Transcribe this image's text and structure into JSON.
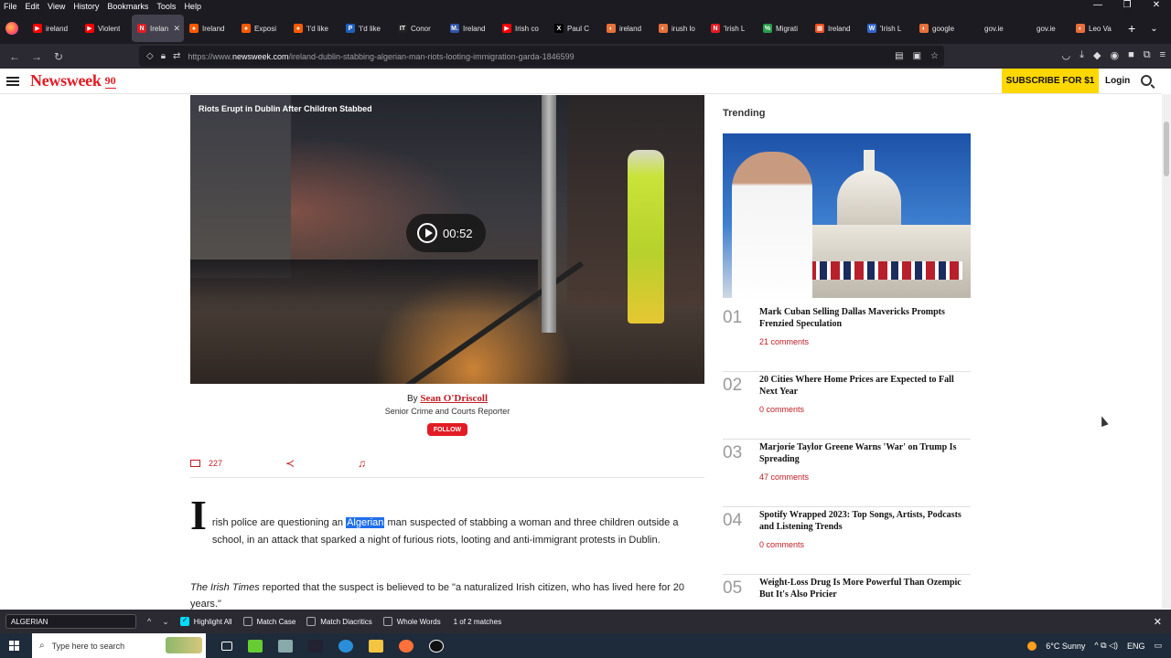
{
  "browser": {
    "menu": [
      "File",
      "Edit",
      "View",
      "History",
      "Bookmarks",
      "Tools",
      "Help"
    ],
    "window_controls": {
      "minimize": "—",
      "restore": "❐",
      "close": "✕"
    },
    "tabs": [
      {
        "label": "ireland",
        "color": "#ff0000",
        "glyph": "▶"
      },
      {
        "label": "Violent",
        "color": "#ff0000",
        "glyph": "▶"
      },
      {
        "label": "Irelan",
        "color": "#e21c24",
        "glyph": "N",
        "active": true
      },
      {
        "label": "Ireland",
        "color": "#ff5a00",
        "glyph": "●"
      },
      {
        "label": "Exposi",
        "color": "#ff5a00",
        "glyph": "●"
      },
      {
        "label": "'I'd like",
        "color": "#ff5a00",
        "glyph": "●"
      },
      {
        "label": "'I'd like",
        "color": "#1e5fbf",
        "glyph": "P"
      },
      {
        "label": "Conor",
        "color": "#222222",
        "glyph": "IT"
      },
      {
        "label": "Ireland",
        "color": "#3355aa",
        "glyph": "M."
      },
      {
        "label": "Irish co",
        "color": "#ff0000",
        "glyph": "▶"
      },
      {
        "label": "Paul C",
        "color": "#000000",
        "glyph": "X"
      },
      {
        "label": "ireland",
        "color": "#e8703a",
        "glyph": "◐"
      },
      {
        "label": "irush lo",
        "color": "#e8703a",
        "glyph": "◐"
      },
      {
        "label": "'Irish L",
        "color": "#e21c24",
        "glyph": "N"
      },
      {
        "label": "Migrati",
        "color": "#2a9d4a",
        "glyph": "%"
      },
      {
        "label": "Ireland",
        "color": "#f25022",
        "glyph": "▦"
      },
      {
        "label": "'Irish L",
        "color": "#3366cc",
        "glyph": "W"
      },
      {
        "label": "google",
        "color": "#e8703a",
        "glyph": "◐"
      },
      {
        "label": "gov.ie",
        "color": "#1c1b22",
        "glyph": ""
      },
      {
        "label": "gov.ie",
        "color": "#1c1b22",
        "glyph": ""
      },
      {
        "label": "Leo Va",
        "color": "#e8703a",
        "glyph": "◐"
      }
    ],
    "tab_close": "✕",
    "new_tab": "+",
    "tab_list": "⌄",
    "url_prefix": "https://www.",
    "url_domain": "newsweek.com",
    "url_path": "/ireland-dublin-stabbing-algerian-man-riots-looting-immigration-garda-1846599",
    "nav": {
      "back": "←",
      "forward": "→",
      "reload": "↻"
    }
  },
  "site": {
    "logo": "Newsweek",
    "logo_badge": "90",
    "subscribe": "SUBSCRIBE FOR $1",
    "login": "Login"
  },
  "article": {
    "video_title": "Riots Erupt in Dublin After Children Stabbed",
    "video_duration": "00:52",
    "by": "By",
    "author": "Sean O'Driscoll",
    "role": "Senior Crime and Courts Reporter",
    "follow": "FOLLOW",
    "comment_count": "227",
    "dropcap": "I",
    "para1_a": "rish police are questioning an",
    "para1_hl": "Algerian",
    "para1_b": "man suspected of stabbing a woman and three children outside a school, in an attack that sparked a night of furious riots, looting and anti-immigrant protests in Dublin.",
    "para2_source": "The Irish Times",
    "para2_text": " reported that the suspect is believed to be \"a naturalized Irish citizen, who has lived here for 20 years.\""
  },
  "trending": {
    "heading": "Trending",
    "items": [
      {
        "num": "01",
        "title": "Mark Cuban Selling Dallas Mavericks Prompts Frenzied Speculation",
        "comments": "21 comments"
      },
      {
        "num": "02",
        "title": "20 Cities Where Home Prices are Expected to Fall Next Year",
        "comments": "0 comments"
      },
      {
        "num": "03",
        "title": "Marjorie Taylor Greene Warns 'War' on Trump Is Spreading",
        "comments": "47 comments"
      },
      {
        "num": "04",
        "title": "Spotify Wrapped 2023: Top Songs, Artists, Podcasts and Listening Trends",
        "comments": "0 comments"
      },
      {
        "num": "05",
        "title": "Weight-Loss Drug Is More Powerful Than Ozempic But It's Also Pricier",
        "comments": ""
      }
    ]
  },
  "findbar": {
    "query": "ALGERIAN",
    "up": "^",
    "down": "⌄",
    "highlight_all": "Highlight All",
    "match_case": "Match Case",
    "match_diacritics": "Match Diacritics",
    "whole_words": "Whole Words",
    "matches": "1 of 2 matches",
    "close": "✕"
  },
  "taskbar": {
    "search_placeholder": "Type here to search",
    "weather": "6°C  Sunny",
    "lang": "ENG",
    "tray_icons": "^  ⧉  ◁)"
  }
}
